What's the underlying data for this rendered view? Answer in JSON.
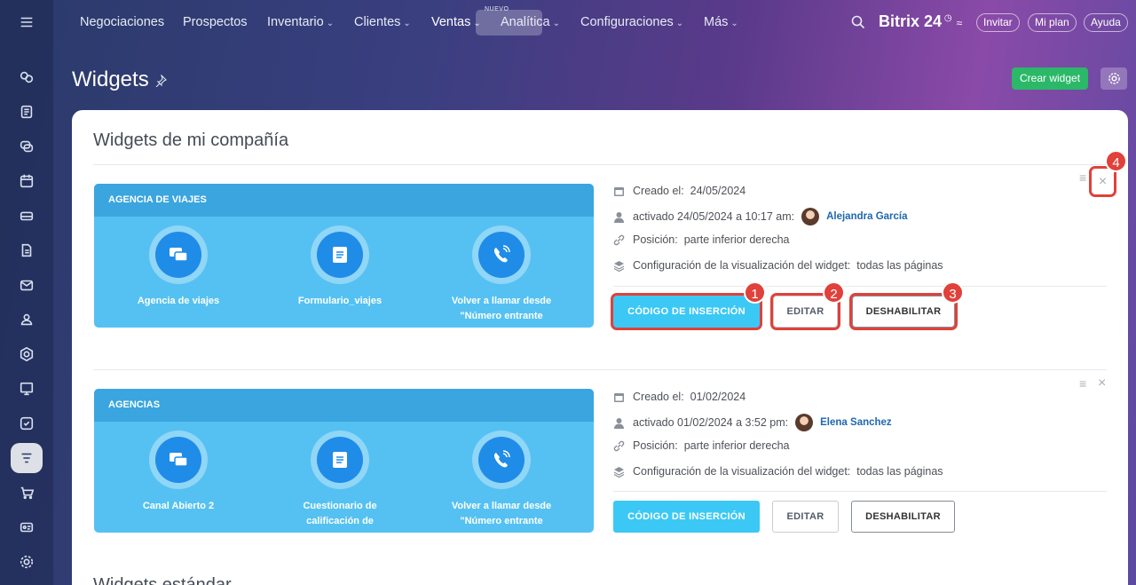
{
  "topnav": {
    "items": [
      {
        "label": "Negociaciones",
        "dropdown": false
      },
      {
        "label": "Prospectos",
        "dropdown": false
      },
      {
        "label": "Inventario",
        "dropdown": true
      },
      {
        "label": "Clientes",
        "dropdown": true
      },
      {
        "label": "Ventas",
        "dropdown": true,
        "active": true,
        "badge": "NUEVO"
      },
      {
        "label": "Analítica",
        "dropdown": true
      },
      {
        "label": "Configuraciones",
        "dropdown": true
      },
      {
        "label": "Más",
        "dropdown": true
      }
    ],
    "brand": "Bitrix 24",
    "invite": "Invitar",
    "plan": "Mi plan",
    "help": "Ayuda"
  },
  "page": {
    "title": "Widgets",
    "create_button": "Crear widget"
  },
  "section": {
    "title": "Widgets de mi compañía",
    "bottom_title": "Widgets estándar"
  },
  "widgets": [
    {
      "name": "AGENCIA DE VIAJES",
      "channels": [
        "Agencia de viajes",
        "Formulario_viajes",
        "Volver a llamar desde \"Número entrante"
      ],
      "created_label": "Creado el:",
      "created": "24/05/2024",
      "activated": "activado 24/05/2024 a 10:17 am:",
      "user": "Alejandra García",
      "position_label": "Posición:",
      "position": "parte inferior derecha",
      "display_label": "Configuración de la visualización del widget:",
      "display": "todas las páginas",
      "buttons": {
        "code": "CÓDIGO DE INSERCIÓN",
        "edit": "EDITAR",
        "disable": "DESHABILITAR"
      }
    },
    {
      "name": "AGENCIAS",
      "channels": [
        "Canal Abierto 2",
        "Cuestionario de calificación de",
        "Volver a llamar desde \"Número entrante"
      ],
      "created_label": "Creado el:",
      "created": "01/02/2024",
      "activated": "activado 01/02/2024 a 3:52 pm:",
      "user": "Elena Sanchez",
      "position_label": "Posición:",
      "position": "parte inferior derecha",
      "display_label": "Configuración de la visualización del widget:",
      "display": "todas las páginas",
      "buttons": {
        "code": "CÓDIGO DE INSERCIÓN",
        "edit": "EDITAR",
        "disable": "DESHABILITAR"
      }
    }
  ],
  "annotations": [
    "1",
    "2",
    "3",
    "4"
  ],
  "colors": {
    "accent": "#3bc8f5",
    "card": "#55c1f2",
    "highlight": "#e0413a",
    "create": "#2bb868"
  }
}
